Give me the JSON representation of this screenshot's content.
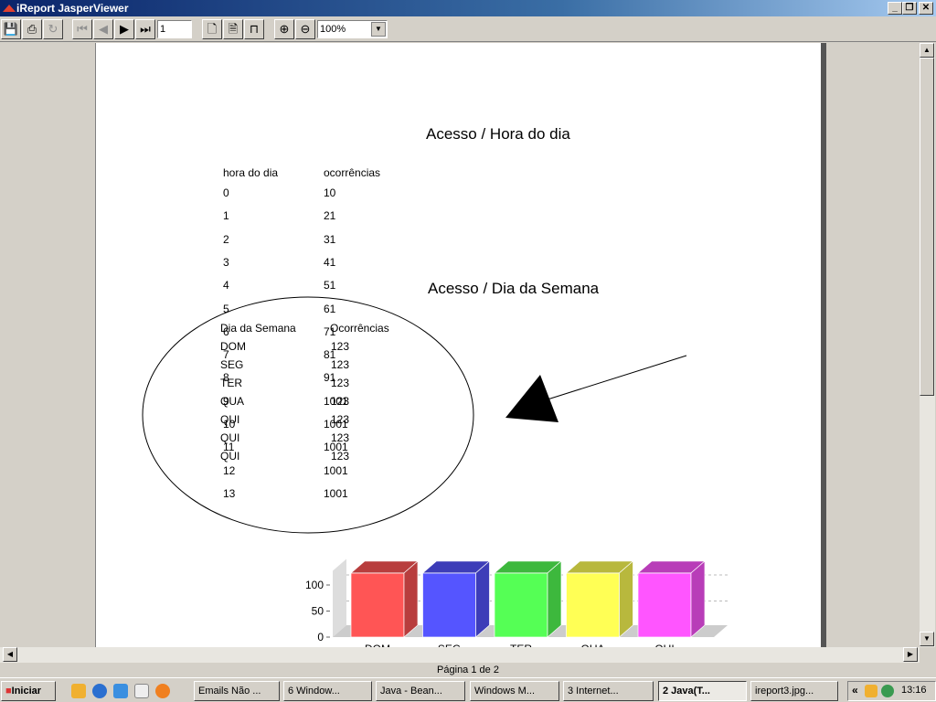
{
  "window": {
    "title": "iReport JasperViewer",
    "min": "_",
    "max": "❐",
    "close": "✕"
  },
  "toolbar": {
    "page_input": "1",
    "zoom_value": "100%",
    "icons": [
      "save-icon",
      "print-icon",
      "reload-icon",
      "first-page-icon",
      "previous-page-icon",
      "next-page-icon",
      "last-page-icon",
      "actual-size-icon",
      "fit-page-icon",
      "fit-width-icon",
      "zoom-in-icon",
      "zoom-out-icon"
    ]
  },
  "report": {
    "title1": "Acesso / Hora do dia",
    "table1": {
      "headers": [
        "hora do dia",
        "ocorrências"
      ],
      "rows": [
        [
          "0",
          "10"
        ],
        [
          "1",
          "21"
        ],
        [
          "2",
          "31"
        ],
        [
          "3",
          "41"
        ],
        [
          "4",
          "51"
        ],
        [
          "5",
          "61"
        ],
        [
          "6",
          "71"
        ],
        [
          "7",
          "81"
        ],
        [
          "8",
          "91"
        ],
        [
          "9",
          "1001"
        ],
        [
          "10",
          "1001"
        ],
        [
          "11",
          "1001"
        ],
        [
          "12",
          "1001"
        ],
        [
          "13",
          "1001"
        ]
      ]
    },
    "title2": "Acesso / Dia da Semana",
    "table2": {
      "headers": [
        "Dia da Semana",
        "Ocorrências"
      ],
      "rows": [
        [
          "DOM",
          "123"
        ],
        [
          "SEG",
          "123"
        ],
        [
          "TER",
          "123"
        ],
        [
          "QUA",
          "123"
        ],
        [
          "QUI",
          "123"
        ],
        [
          "QUI",
          "123"
        ],
        [
          "QUI",
          "123"
        ]
      ]
    },
    "chart_data": {
      "type": "bar",
      "categories": [
        "DOM",
        "SEG",
        "TER",
        "QUA",
        "QUI"
      ],
      "values": [
        123,
        123,
        123,
        123,
        123
      ],
      "colors": [
        "#ff5555",
        "#5555ff",
        "#55ff55",
        "#ffff55",
        "#ff55ff"
      ],
      "yticks": [
        0,
        50,
        100
      ],
      "ylim": [
        0,
        150
      ],
      "grid": true
    }
  },
  "status": {
    "page_label": "Página 1 de 2"
  },
  "taskbar": {
    "start": "Iniciar",
    "tasks": [
      "Emails Não ...",
      "6 Window...",
      "Java - Bean...",
      "Windows M...",
      "3 Internet...",
      "2 Java(T...",
      "ireport3.jpg..."
    ],
    "clock": "13:16",
    "tray_expand": "«"
  }
}
